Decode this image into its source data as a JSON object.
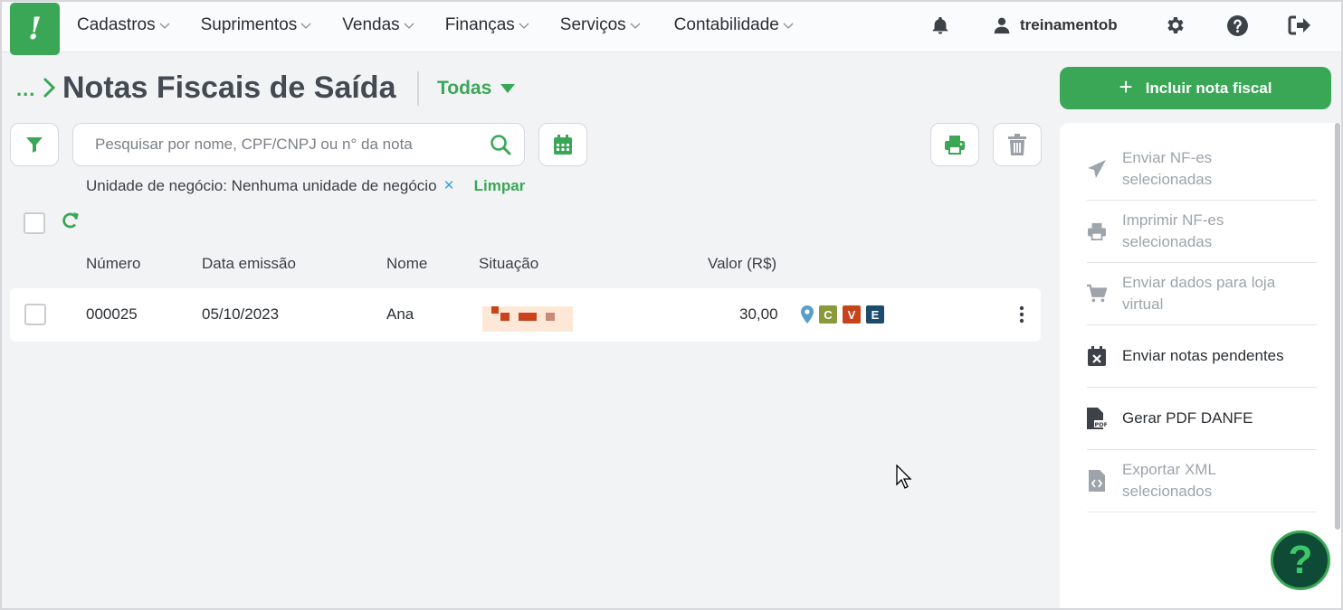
{
  "app": {
    "logo_glyph": "!",
    "brand_color": "#3aa757"
  },
  "nav": [
    {
      "label": "Cadastros"
    },
    {
      "label": "Suprimentos"
    },
    {
      "label": "Vendas"
    },
    {
      "label": "Finanças"
    },
    {
      "label": "Serviços"
    },
    {
      "label": "Contabilidade"
    }
  ],
  "user": {
    "name": "treinamentob",
    "icons": [
      "bell-icon",
      "user-icon",
      "gear-icon",
      "help-icon",
      "logout-icon"
    ]
  },
  "breadcrumb": {
    "dots": "..."
  },
  "page": {
    "title": "Notas Fiscais de Saída",
    "filter_value": "Todas"
  },
  "search": {
    "placeholder": "Pesquisar por nome, CPF/CNPJ ou n° da nota",
    "value": ""
  },
  "filter_chip": {
    "label": "Unidade de negócio: Nenhuma unidade de negócio",
    "remove": "×",
    "clear": "Limpar"
  },
  "table": {
    "headers": {
      "numero": "Número",
      "data": "Data emissão",
      "nome": "Nome",
      "situacao": "Situação",
      "valor": "Valor (R$)"
    },
    "rows": [
      {
        "numero": "000025",
        "data": "05/10/2023",
        "nome": "Ana",
        "valor": "30,00",
        "tags": [
          "C",
          "V",
          "E"
        ]
      }
    ]
  },
  "tag_colors": {
    "C": "#8a9a3a",
    "V": "#c9431a",
    "E": "#1c4b6e"
  },
  "actions": {
    "add": "Incluir nota fiscal",
    "items": [
      {
        "label_1": "Enviar NF-es",
        "label_2": "selecionadas"
      },
      {
        "label_1": "Imprimir NF-es",
        "label_2": "selecionadas"
      },
      {
        "label_1": "Enviar dados para loja",
        "label_2": "virtual"
      },
      {
        "label_1": "Enviar notas pendentes"
      },
      {
        "label_1": "Gerar PDF DANFE"
      },
      {
        "label_1": "Exportar XML",
        "label_2": "selecionados"
      }
    ]
  },
  "help_fab": {
    "glyph": "?"
  }
}
